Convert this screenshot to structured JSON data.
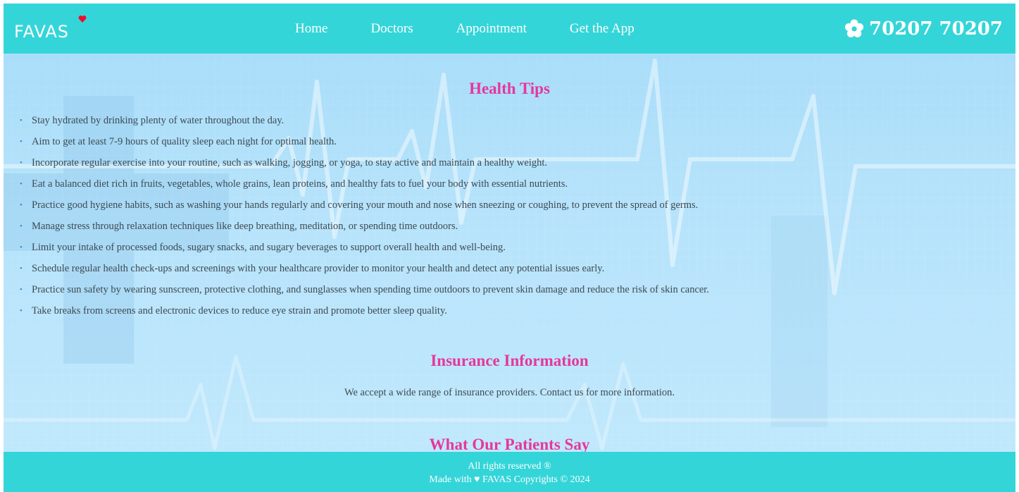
{
  "brand": {
    "logo_text": "FAVAS",
    "accent": "#34d5d8",
    "heart_color": "#e8112d"
  },
  "nav": {
    "items": [
      {
        "label": "Home"
      },
      {
        "label": "Doctors"
      },
      {
        "label": "Appointment"
      },
      {
        "label": "Get the App"
      }
    ],
    "phone_icon": "flower-icon",
    "phone": "70207 70207"
  },
  "health_tips": {
    "title": "Health Tips",
    "title_color": "#e6379b",
    "tips": [
      "Stay hydrated by drinking plenty of water throughout the day.",
      "Aim to get at least 7-9 hours of quality sleep each night for optimal health.",
      "Incorporate regular exercise into your routine, such as walking, jogging, or yoga, to stay active and maintain a healthy weight.",
      "Eat a balanced diet rich in fruits, vegetables, whole grains, lean proteins, and healthy fats to fuel your body with essential nutrients.",
      "Practice good hygiene habits, such as washing your hands regularly and covering your mouth and nose when sneezing or coughing, to prevent the spread of germs.",
      "Manage stress through relaxation techniques like deep breathing, meditation, or spending time outdoors.",
      "Limit your intake of processed foods, sugary snacks, and sugary beverages to support overall health and well-being.",
      "Schedule regular health check-ups and screenings with your healthcare provider to monitor your health and detect any potential issues early.",
      "Practice sun safety by wearing sunscreen, protective clothing, and sunglasses when spending time outdoors to prevent skin damage and reduce the risk of skin cancer.",
      "Take breaks from screens and electronic devices to reduce eye strain and promote better sleep quality."
    ]
  },
  "insurance": {
    "title": "Insurance Information",
    "text": "We accept a wide range of insurance providers. Contact us for more information."
  },
  "testimonials": {
    "title": "What Our Patients Say"
  },
  "footer": {
    "line1": "All rights reserved ®",
    "line2": "Made with ♥ FAVAS Copyrights © 2024"
  }
}
